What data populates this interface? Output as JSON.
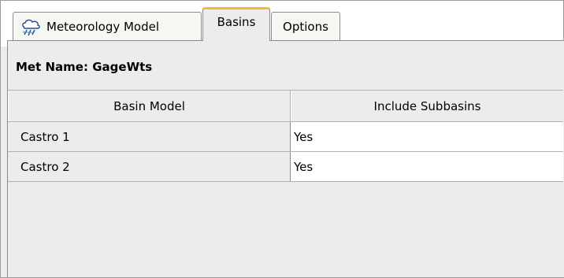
{
  "tabs": [
    {
      "label": "Meteorology Model",
      "icon": "meteorology-icon",
      "selected": false
    },
    {
      "label": "Basins",
      "selected": true
    },
    {
      "label": "Options",
      "selected": false
    }
  ],
  "met_name": {
    "label": "Met Name:",
    "value": "GageWts"
  },
  "table": {
    "columns": [
      "Basin Model",
      "Include Subbasins"
    ],
    "rows": [
      {
        "basin_model": "Castro 1",
        "include_subbasins": "Yes"
      },
      {
        "basin_model": "Castro 2",
        "include_subbasins": "Yes"
      }
    ]
  },
  "colors": {
    "selected_tab_accent": "#f2b83a",
    "panel_background": "#ececec",
    "cell_background": "#ffffff"
  }
}
